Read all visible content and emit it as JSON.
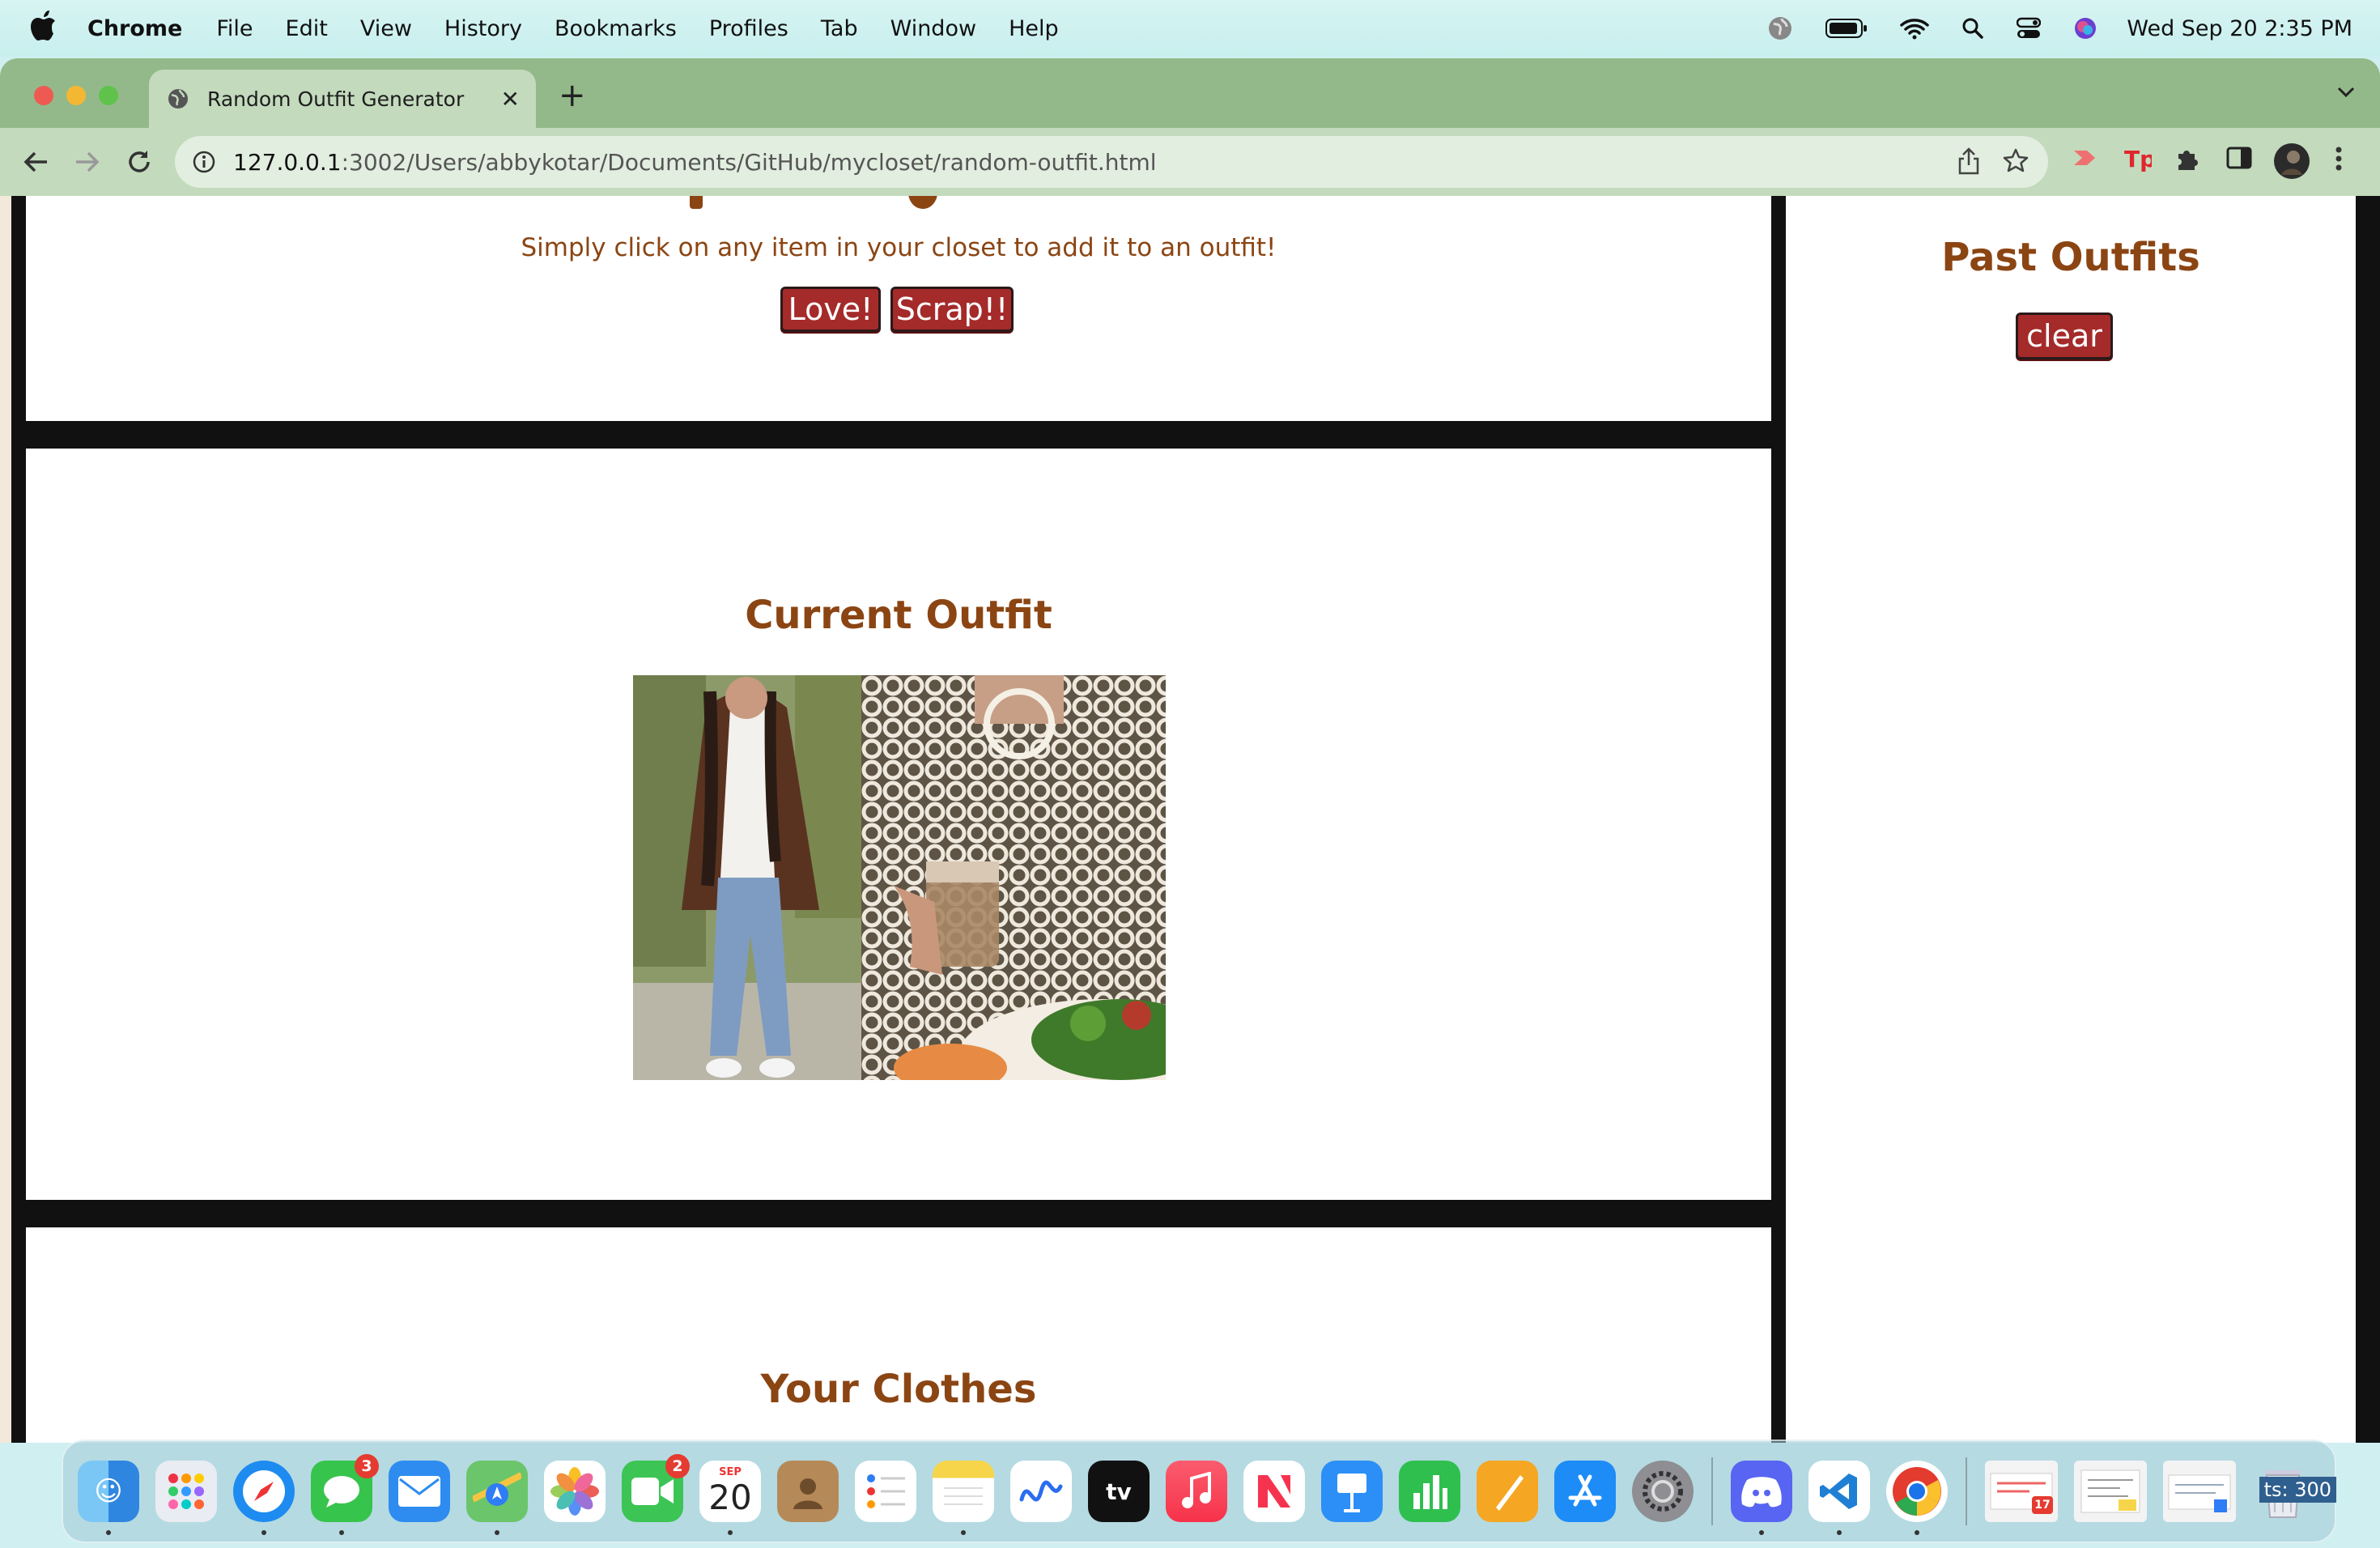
{
  "menubar": {
    "app_name": "Chrome",
    "menus": [
      "File",
      "Edit",
      "View",
      "History",
      "Bookmarks",
      "Profiles",
      "Tab",
      "Window",
      "Help"
    ],
    "clock": "Wed Sep 20  2:35 PM"
  },
  "browser": {
    "tab_title": "Random Outfit Generator",
    "url_host": "127.0.0.1",
    "url_rest": ":3002/Users/abbykotar/Documents/GitHub/mycloset/random-outfit.html"
  },
  "page": {
    "instructions": "Simply click on any item in your closet to add it to an outfit!",
    "love_button": "Love!",
    "scrap_button": "Scrap!!",
    "current_outfit_heading": "Current Outfit",
    "your_clothes_heading": "Your Clothes",
    "past_outfits_heading": "Past Outfits",
    "clear_button": "clear"
  },
  "dock": {
    "messages_badge": "3",
    "facetime_badge": "2",
    "calendar_month": "SEP",
    "calendar_day": "20",
    "downloads_badge": "17",
    "clipped_text": "ts: 300",
    "apps": [
      "Finder",
      "Launchpad",
      "Safari",
      "Messages",
      "Mail",
      "Maps",
      "Photos",
      "FaceTime",
      "Calendar",
      "Contacts",
      "Reminders",
      "Notes",
      "Freeform",
      "TV",
      "Music",
      "News",
      "Keynote",
      "Numbers",
      "Pages",
      "App Store",
      "System Settings",
      "Discord",
      "Visual Studio Code",
      "Google Chrome"
    ]
  },
  "colors": {
    "heading_brown": "#8b4513",
    "button_red": "#a52a2a",
    "tabstrip_green": "#93b98a",
    "toolbar_green": "#c3dabd"
  }
}
